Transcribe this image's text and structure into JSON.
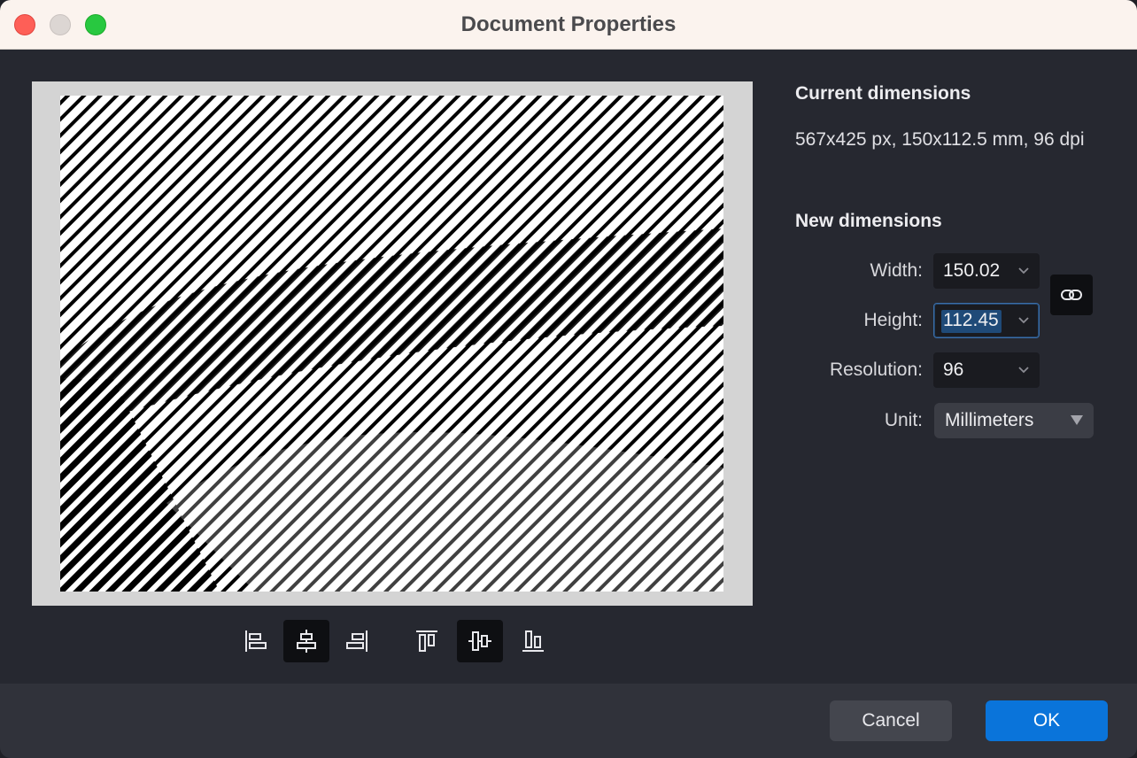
{
  "window": {
    "title": "Document Properties"
  },
  "current": {
    "heading": "Current dimensions",
    "value": "567x425 px, 150x112.5 mm, 96 dpi"
  },
  "new_dims": {
    "heading": "New dimensions",
    "width_label": "Width:",
    "width_value": "150.02",
    "height_label": "Height:",
    "height_value": "112.45",
    "resolution_label": "Resolution:",
    "resolution_value": "96",
    "unit_label": "Unit:",
    "unit_value": "Millimeters"
  },
  "footer": {
    "cancel_label": "Cancel",
    "ok_label": "OK"
  },
  "colors": {
    "accent": "#0a74da",
    "focus_border": "#3b6ea8"
  }
}
